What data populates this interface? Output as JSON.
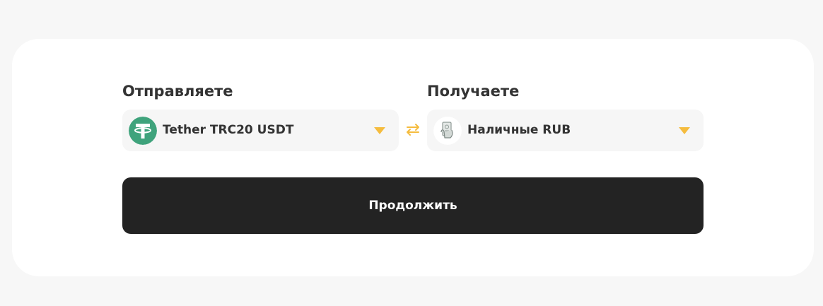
{
  "exchange": {
    "send_label": "Отправляете",
    "receive_label": "Получаете",
    "send_currency": {
      "name": "Tether TRC20 USDT",
      "icon": "tether-usdt-icon"
    },
    "receive_currency": {
      "name": "Наличные RUB",
      "icon": "cash-rub-icon"
    },
    "swap_icon": "swap-arrows-icon",
    "continue_label": "Продолжить"
  },
  "colors": {
    "accent": "#f5bc3e",
    "tether": "#3fa37c",
    "button": "#232323",
    "text": "#333333",
    "background": "#f7f7f7",
    "card": "#ffffff",
    "select_bg": "#f6f6f6"
  }
}
